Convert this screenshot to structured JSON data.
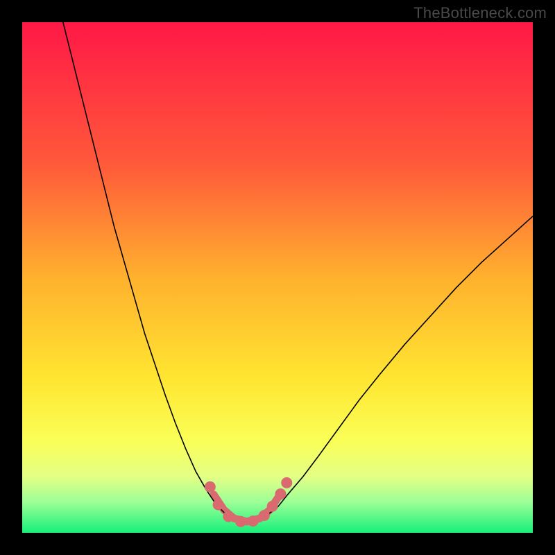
{
  "watermark": "TheBottleneck.com",
  "chart_data": {
    "type": "line",
    "title": "",
    "xlabel": "",
    "ylabel": "",
    "xlim": [
      0,
      100
    ],
    "ylim": [
      0,
      100
    ],
    "gradient_stops": [
      {
        "offset": 0,
        "color": "#ff1846"
      },
      {
        "offset": 28,
        "color": "#ff5a3a"
      },
      {
        "offset": 50,
        "color": "#ffb12e"
      },
      {
        "offset": 70,
        "color": "#ffe631"
      },
      {
        "offset": 82,
        "color": "#faff57"
      },
      {
        "offset": 89,
        "color": "#e3ff85"
      },
      {
        "offset": 94,
        "color": "#9cff96"
      },
      {
        "offset": 100,
        "color": "#16f07a"
      }
    ],
    "series": [
      {
        "name": "left-branch",
        "type": "line",
        "color": "#000000",
        "width": 1.6,
        "points": [
          {
            "x": 8,
            "y": 100
          },
          {
            "x": 10,
            "y": 92
          },
          {
            "x": 12,
            "y": 84
          },
          {
            "x": 14,
            "y": 76
          },
          {
            "x": 16,
            "y": 68
          },
          {
            "x": 18,
            "y": 60
          },
          {
            "x": 20,
            "y": 53
          },
          {
            "x": 22,
            "y": 46
          },
          {
            "x": 24,
            "y": 39
          },
          {
            "x": 26,
            "y": 33
          },
          {
            "x": 28,
            "y": 27
          },
          {
            "x": 30,
            "y": 21.5
          },
          {
            "x": 32,
            "y": 16.5
          },
          {
            "x": 34,
            "y": 12
          },
          {
            "x": 36,
            "y": 8.5
          },
          {
            "x": 38,
            "y": 5.5
          },
          {
            "x": 40,
            "y": 3.5
          }
        ]
      },
      {
        "name": "right-branch",
        "type": "line",
        "color": "#000000",
        "width": 1.6,
        "points": [
          {
            "x": 48,
            "y": 3.5
          },
          {
            "x": 50,
            "y": 5
          },
          {
            "x": 52,
            "y": 7.5
          },
          {
            "x": 55,
            "y": 11
          },
          {
            "x": 58,
            "y": 15
          },
          {
            "x": 62,
            "y": 20.5
          },
          {
            "x": 66,
            "y": 26
          },
          {
            "x": 70,
            "y": 31
          },
          {
            "x": 75,
            "y": 37
          },
          {
            "x": 80,
            "y": 42.5
          },
          {
            "x": 85,
            "y": 48
          },
          {
            "x": 90,
            "y": 53
          },
          {
            "x": 95,
            "y": 57.5
          },
          {
            "x": 100,
            "y": 62
          }
        ]
      },
      {
        "name": "valley-highlight",
        "type": "line",
        "color": "#d96a6f",
        "width": 11,
        "linecap": "round",
        "points": [
          {
            "x": 37.5,
            "y": 7.5
          },
          {
            "x": 39.5,
            "y": 4.5
          },
          {
            "x": 41.5,
            "y": 2.8
          },
          {
            "x": 44,
            "y": 2.2
          },
          {
            "x": 46.5,
            "y": 2.8
          },
          {
            "x": 48.5,
            "y": 4.5
          },
          {
            "x": 50.5,
            "y": 7.5
          }
        ]
      },
      {
        "name": "valley-markers",
        "type": "scatter",
        "color": "#d96a6f",
        "radius": 8,
        "points": [
          {
            "x": 36.8,
            "y": 9.0
          },
          {
            "x": 38.4,
            "y": 5.5
          },
          {
            "x": 40.4,
            "y": 3.2
          },
          {
            "x": 42.8,
            "y": 2.2
          },
          {
            "x": 45.2,
            "y": 2.3
          },
          {
            "x": 47.4,
            "y": 3.4
          },
          {
            "x": 49.0,
            "y": 5.2
          },
          {
            "x": 50.6,
            "y": 7.6
          },
          {
            "x": 51.8,
            "y": 9.8
          }
        ]
      }
    ]
  }
}
